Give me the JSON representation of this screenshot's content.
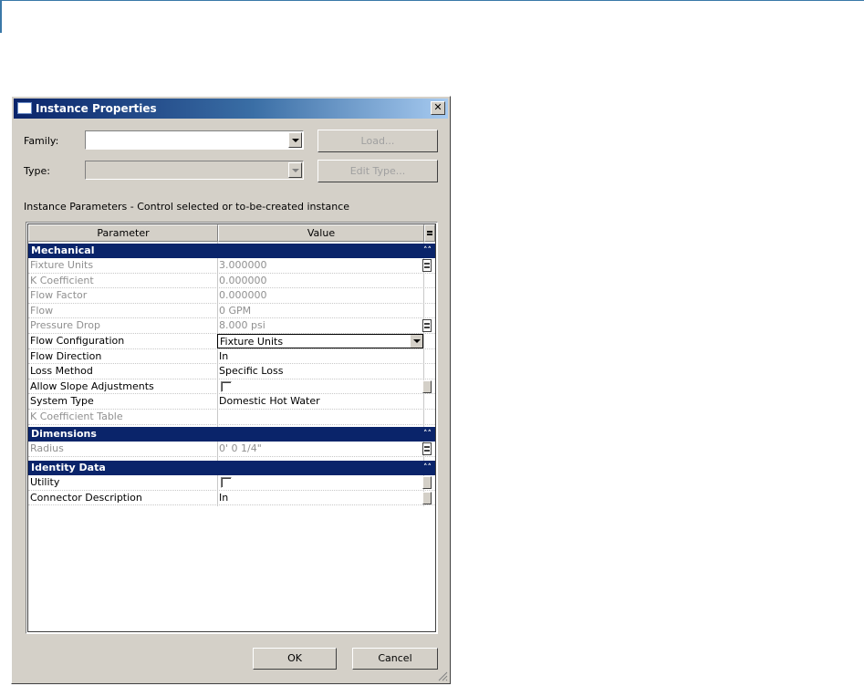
{
  "window": {
    "title": "Instance Properties",
    "close_glyph": "✕"
  },
  "family": {
    "label": "Family:",
    "value": "",
    "load_button": "Load..."
  },
  "type": {
    "label": "Type:",
    "value": "",
    "edit_type_button": "Edit Type..."
  },
  "instance_caption": "Instance Parameters - Control selected or to-be-created instance",
  "grid": {
    "headers": {
      "parameter": "Parameter",
      "value": "Value"
    },
    "sections": [
      {
        "name": "Mechanical",
        "rows": [
          {
            "parameter": "Fixture Units",
            "value": "3.000000",
            "readonly": true
          },
          {
            "parameter": "K Coefficient",
            "value": "0.000000",
            "readonly": true
          },
          {
            "parameter": "Flow Factor",
            "value": "0.000000",
            "readonly": true
          },
          {
            "parameter": "Flow",
            "value": "0 GPM",
            "readonly": true
          },
          {
            "parameter": "Pressure Drop",
            "value": "8.000 psi",
            "readonly": true
          },
          {
            "parameter": "Flow Configuration",
            "value": "Fixture Units",
            "readonly": false
          },
          {
            "parameter": "Flow Direction",
            "value": "In",
            "readonly": false
          },
          {
            "parameter": "Loss Method",
            "value": "Specific Loss",
            "readonly": false
          },
          {
            "parameter": "Allow Slope Adjustments",
            "value": "",
            "readonly": false
          },
          {
            "parameter": "System Type",
            "value": "Domestic Hot Water",
            "readonly": false
          },
          {
            "parameter": "K Coefficient Table",
            "value": "",
            "readonly": true
          }
        ]
      },
      {
        "name": "Dimensions",
        "rows": [
          {
            "parameter": "Radius",
            "value": "0'  0 1/4\"",
            "readonly": true
          }
        ]
      },
      {
        "name": "Identity Data",
        "rows": [
          {
            "parameter": "Utility",
            "value": "",
            "readonly": false
          },
          {
            "parameter": "Connector Description",
            "value": "In",
            "readonly": false
          }
        ]
      }
    ]
  },
  "buttons": {
    "ok": "OK",
    "cancel": "Cancel"
  },
  "colors": {
    "section_header": "#0a246a",
    "dialog_bg": "#d4d0c8",
    "readonly_text": "#909090"
  }
}
